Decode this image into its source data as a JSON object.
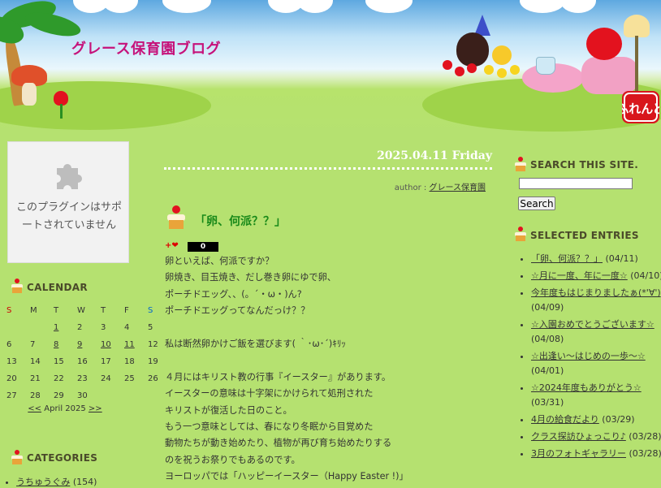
{
  "header": {
    "title": "グレース保育園ブログ",
    "logo_badge": "ふれんど"
  },
  "left_sidebar": {
    "plugin_notice": "このプラグインはサポートされていません",
    "calendar": {
      "heading": "CALENDAR",
      "weekdays": [
        "S",
        "M",
        "T",
        "W",
        "T",
        "F",
        "S"
      ],
      "weeks": [
        [
          "",
          "",
          "1",
          "2",
          "3",
          "4",
          "5"
        ],
        [
          "6",
          "7",
          "8",
          "9",
          "10",
          "11",
          "12"
        ],
        [
          "13",
          "14",
          "15",
          "16",
          "17",
          "18",
          "19"
        ],
        [
          "20",
          "21",
          "22",
          "23",
          "24",
          "25",
          "26"
        ],
        [
          "27",
          "28",
          "29",
          "30",
          "",
          "",
          ""
        ]
      ],
      "linked_days": [
        "1",
        "8",
        "9",
        "10",
        "11"
      ],
      "nav_prev": "<<",
      "nav_month": "April 2025",
      "nav_next": ">>"
    },
    "categories": {
      "heading": "CATEGORIES",
      "items": [
        {
          "label": "うちゅうぐみ",
          "count": "(154)"
        }
      ]
    }
  },
  "main": {
    "date": "2025.04.11 Friday",
    "author_prefix": "author :",
    "author_name": "グレース保育園",
    "entry_title": "「卵、何派？？」",
    "like_count": "0",
    "body_lines": [
      "卵といえば、何派ですか？",
      "卵焼き、目玉焼き、だし巻き卵にゆで卵、",
      "ポーチドエッグ、、(。´・ω・)ん?",
      "ポーチドエッグってなんだっけ？？",
      "",
      "私は断然卵かけご飯を選びます( ｀･ω･´)ｷﾘｯ",
      "",
      "４月にはキリスト教の行事『イースター』があります。",
      "イースターの意味は十字架にかけられて処刑された",
      "キリストが復活した日のこと。",
      "もう一つ意味としては、春になり冬眠から目覚めた",
      "動物たちが動き始めたり、植物が再び育ち始めたりする",
      "のを祝うお祭りでもあるのです。",
      "ヨーロッパでは「ハッピーイースター（Happy Easter !)」"
    ]
  },
  "right_sidebar": {
    "search_heading": "SEARCH THIS SITE.",
    "search_value": "",
    "search_button": "Search",
    "entries_heading": "SELECTED ENTRIES",
    "entries": [
      {
        "title": "「卵、何派？？」",
        "date": " (04/11)"
      },
      {
        "title": "☆月に一度、年に一度☆",
        "date": " (04/10)"
      },
      {
        "title": "今年度もはじまりましたぁ(*'∀')",
        "date": " (04/09)"
      },
      {
        "title": "☆入園おめでとうございます☆",
        "date": " (04/08)"
      },
      {
        "title": "☆出逢い〜はじめの一歩〜☆",
        "date": " (04/01)"
      },
      {
        "title": "☆2024年度もありがとう☆",
        "date": " (03/31)"
      },
      {
        "title": "4月の給食だより",
        "date": " (03/29)"
      },
      {
        "title": "クラス探訪ひょっこり♪",
        "date": " (03/28)"
      },
      {
        "title": "3月のフォトギャラリー",
        "date": " (03/28)"
      }
    ]
  },
  "colors": {
    "page_background": "#b5e170",
    "title_pink": "#c6127a",
    "entry_title_green": "#1a8a1a"
  },
  "icons": [
    "puzzle-icon",
    "cake-icon",
    "heart-icon",
    "palm-tree-icon",
    "mushroom-icon",
    "tulip-icon",
    "apple-character-icon",
    "lamp-icon"
  ]
}
